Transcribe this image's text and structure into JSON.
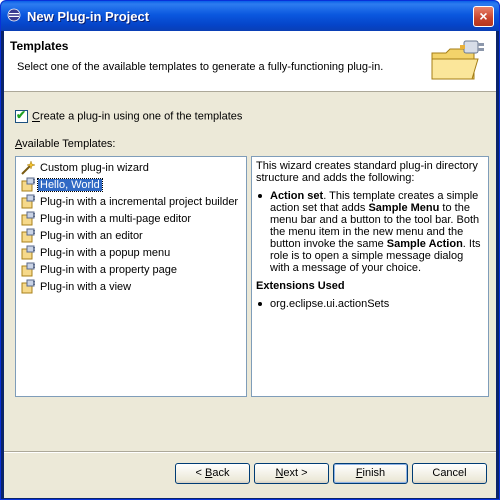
{
  "window": {
    "title": "New Plug-in Project",
    "close_label": "×"
  },
  "header": {
    "title": "Templates",
    "description": "Select one of the available templates to generate a fully-functioning plug-in."
  },
  "checkbox": {
    "checked": true,
    "label_mnemonic": "C",
    "label_rest": "reate a plug-in using one of the templates"
  },
  "templates_label": {
    "mnemonic": "A",
    "rest": "vailable Templates:"
  },
  "templates": [
    {
      "label": "Custom plug-in wizard",
      "icon": "wand-icon",
      "selected": false
    },
    {
      "label": "Hello, World",
      "icon": "plugin-icon",
      "selected": true
    },
    {
      "label": "Plug-in with a incremental project builder",
      "icon": "plugin-icon",
      "selected": false
    },
    {
      "label": "Plug-in with a multi-page editor",
      "icon": "plugin-icon",
      "selected": false
    },
    {
      "label": "Plug-in with an editor",
      "icon": "plugin-icon",
      "selected": false
    },
    {
      "label": "Plug-in with a popup menu",
      "icon": "plugin-icon",
      "selected": false
    },
    {
      "label": "Plug-in with a property page",
      "icon": "plugin-icon",
      "selected": false
    },
    {
      "label": "Plug-in with a view",
      "icon": "plugin-icon",
      "selected": false
    }
  ],
  "description": {
    "intro": "This wizard creates standard plug-in directory structure and adds the following:",
    "bullet_title": "Action set",
    "bullet_text_1": ". This template creates a simple action set that adds ",
    "bullet_bold_1": "Sample Menu",
    "bullet_text_2": " to the menu bar and a button to the tool bar. Both the menu item in the new menu and the button invoke the same ",
    "bullet_bold_2": "Sample Action",
    "bullet_text_3": ". Its role is to open a simple message dialog with a message of your choice.",
    "extensions_title": "Extensions Used",
    "extension": "org.eclipse.ui.actionSets"
  },
  "buttons": {
    "back_prefix": "< ",
    "back_mnemonic": "B",
    "back_rest": "ack",
    "next_mnemonic": "N",
    "next_rest": "ext >",
    "finish_mnemonic": "F",
    "finish_rest": "inish",
    "cancel": "Cancel"
  },
  "colors": {
    "titlebar": "#0b58df",
    "selection": "#316ac5",
    "dialog_bg": "#ece9d8"
  }
}
